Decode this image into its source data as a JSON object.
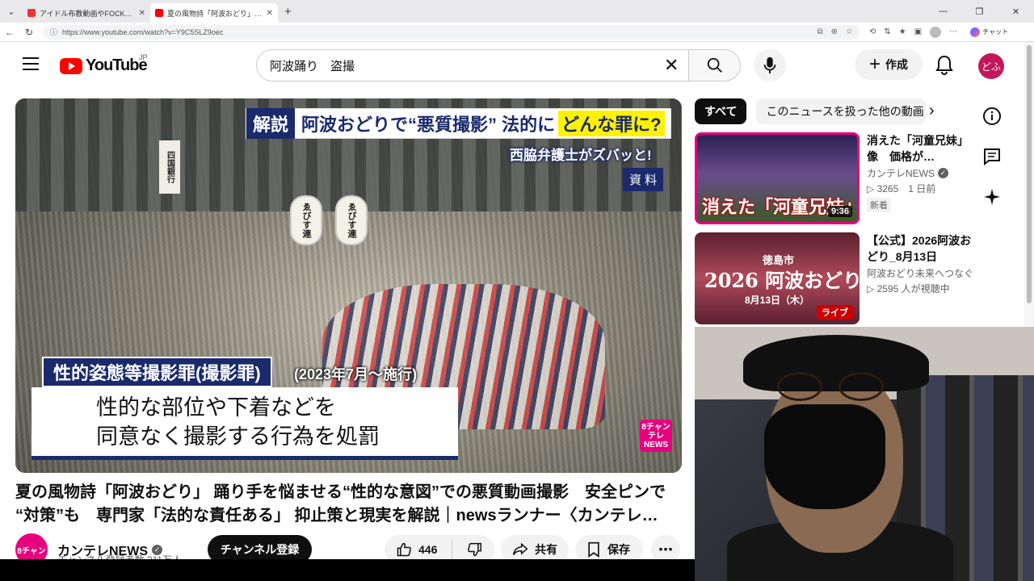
{
  "browser": {
    "tabs": [
      {
        "title": "アイドル布教動画やFOCKニュース(話) | Ko...",
        "active": false
      },
      {
        "title": "夏の風物詩「阿波おどり」踊り手を...",
        "active": true
      }
    ],
    "url": "https://www.youtube.com/watch?v=Y9C5SLZ9oec",
    "copilot_label": "チャット"
  },
  "youtube": {
    "logo_text": "YouTube",
    "region": "JP",
    "search_query": "阿波踊り　盗撮",
    "create_label": "作成",
    "avatar_text": "どふ"
  },
  "video": {
    "overlay": {
      "kaisetsu": "解説",
      "headline": "阿波おどりで“悪質撮影”  法的に",
      "headline_hl": "どんな罪に?",
      "sub": "西脇弁護士がズバッと!",
      "shiryo": "資 料",
      "lantern1": "ゑびす連",
      "lantern2": "ゑびす連",
      "banner": "四国銀行",
      "caption_head": "性的姿態等撮影罪(撮影罪)",
      "caption_note": "(2023年7月～施行)",
      "caption_line1": "性的な部位や下着などを",
      "caption_line2": "同意なく撮影する行為を処罰",
      "badge": "8チャン テレ NEWS"
    },
    "title_line1": "夏の風物詩「阿波おどり」 踊り手を悩ませる“性的な意図”での悪質動画撮影　安全ピンで",
    "title_line2": "“対策”も　専門家「法的な責任ある」 抑止策と現実を解説｜newsランナー〈カンテレ…",
    "channel_name": "カンテレNEWS",
    "channel_avatar": "8チャン",
    "subscribers": "チャンネル登録者数 211万人",
    "subscribe_label": "チャンネル登録",
    "likes": "446",
    "share_label": "共有",
    "save_label": "保存"
  },
  "sidebar": {
    "chips": [
      "すべて",
      "このニュースを扱った他の動画"
    ],
    "recommendations": [
      {
        "title": "消えた「河童兄妹」像　価格が…",
        "channel": "カンテレNEWS",
        "meta": "▷ 3265　1 日前",
        "badge": "新着",
        "thumb_text": "消えた「河童兄妹」像",
        "duration": "9:36"
      },
      {
        "title": "【公式】2026阿波おどり_8月13日",
        "channel": "阿波おどり未来へつなぐ実行委員会",
        "meta": "▷ 2595 人が視聴中",
        "thumb_city": "徳島市",
        "thumb_text": "2026 阿波おどり",
        "thumb_date": "8月13日（木）",
        "live": "ライブ"
      }
    ]
  },
  "colors": {
    "brand_red": "#ff0000",
    "news_navy": "#1a2a6c",
    "kantele_pink": "#e6007e"
  }
}
